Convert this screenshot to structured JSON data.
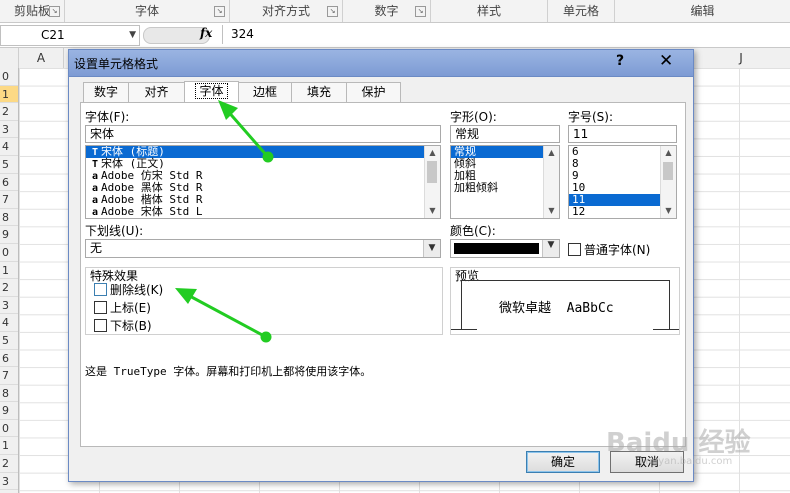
{
  "ribbon": {
    "groups": [
      "剪贴板",
      "字体",
      "对齐方式",
      "数字",
      "样式",
      "单元格",
      "编辑"
    ]
  },
  "formula_bar": {
    "cell_ref": "C21",
    "fx_label": "fx",
    "value": "324"
  },
  "columns": [
    "A",
    "J"
  ],
  "rows": [
    "0",
    "1",
    "2",
    "3",
    "4",
    "5",
    "6",
    "7",
    "8",
    "9",
    "0",
    "1",
    "2",
    "3",
    "4",
    "5",
    "6",
    "7",
    "8",
    "9",
    "0",
    "1",
    "2",
    "3"
  ],
  "dialog": {
    "title": "设置单元格格式",
    "help": "?",
    "close": "✕",
    "tabs": [
      "数字",
      "对齐",
      "字体",
      "边框",
      "填充",
      "保护"
    ],
    "active_tab": "字体",
    "font": {
      "label": "字体(F):",
      "value": "宋体",
      "items": [
        "宋体 (标题)",
        "宋体 (正文)",
        "Adobe 仿宋 Std R",
        "Adobe 黑体 Std R",
        "Adobe 楷体 Std R",
        "Adobe 宋体 Std L"
      ],
      "item_icons": [
        "T",
        "T",
        "a",
        "a",
        "a",
        "a"
      ],
      "selected_index": 0
    },
    "style": {
      "label": "字形(O):",
      "value": "常规",
      "items": [
        "常规",
        "倾斜",
        "加粗",
        "加粗倾斜"
      ],
      "selected_index": 0
    },
    "size": {
      "label": "字号(S):",
      "value": "11",
      "items": [
        "6",
        "8",
        "9",
        "10",
        "11",
        "12"
      ],
      "selected_index": 4
    },
    "underline": {
      "label": "下划线(U):",
      "value": "无"
    },
    "color": {
      "label": "颜色(C):",
      "swatch": "#000000"
    },
    "normal_font": {
      "label": "普通字体(N)",
      "checked": false
    },
    "effects": {
      "title": "特殊效果",
      "strikethrough": "删除线(K)",
      "superscript": "上标(E)",
      "subscript": "下标(B)"
    },
    "preview": {
      "title": "预览",
      "sample": "微软卓越  AaBbCc"
    },
    "info": "这是 TrueType 字体。屏幕和打印机上都将使用该字体。",
    "ok": "确定",
    "cancel": "取消"
  },
  "watermark": {
    "text": "Baidu 经验",
    "url": "jingyan.baidu.com"
  },
  "colors": {
    "accent": "#0a6ad2",
    "annotation": "#22cc22",
    "title_bar": "#8ca8dc"
  }
}
